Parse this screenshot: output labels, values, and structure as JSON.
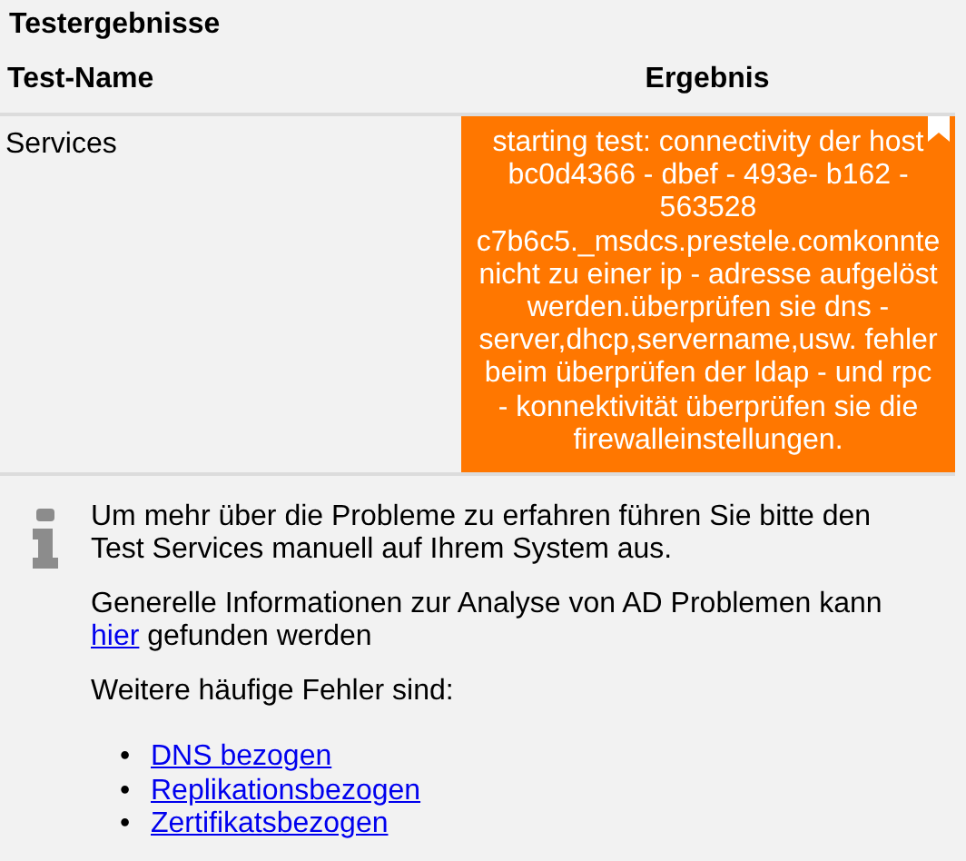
{
  "title": "Testergebnisse",
  "table": {
    "columns": [
      "Test-Name",
      "Ergebnis"
    ],
    "rows": [
      {
        "name": "Services",
        "result": "starting test: connectivity der host bc0d4366 - dbef - 493e- b162 - 563528 c7b6c5._msdcs.prestele.comkonnte nicht zu einer ip - adresse aufgelöst werden.überprüfen sie dns - server,dhcp,servername,usw. fehler beim überprüfen der ldap - und rpc - konnektivität überprüfen sie die firewalleinstellungen.",
        "color": "#ff7700"
      }
    ]
  },
  "info": {
    "paragraphs": [
      {
        "text": "Um mehr über die Probleme zu erfahren führen Sie bitte den Test Services manuell auf Ihrem System aus."
      },
      {
        "text": "Generelle Informationen zur Analyse von AD Problemen kann",
        "link": "hier",
        "after": "gefunden werden"
      },
      {
        "text": "Weitere häufige Fehler sind:"
      }
    ],
    "links": [
      {
        "bullet": "•",
        "label": "DNS bezogen"
      },
      {
        "bullet": "•",
        "label": "Replikationsbezogen"
      },
      {
        "bullet": "•",
        "label": "Zertifikatsbezogen"
      }
    ]
  }
}
